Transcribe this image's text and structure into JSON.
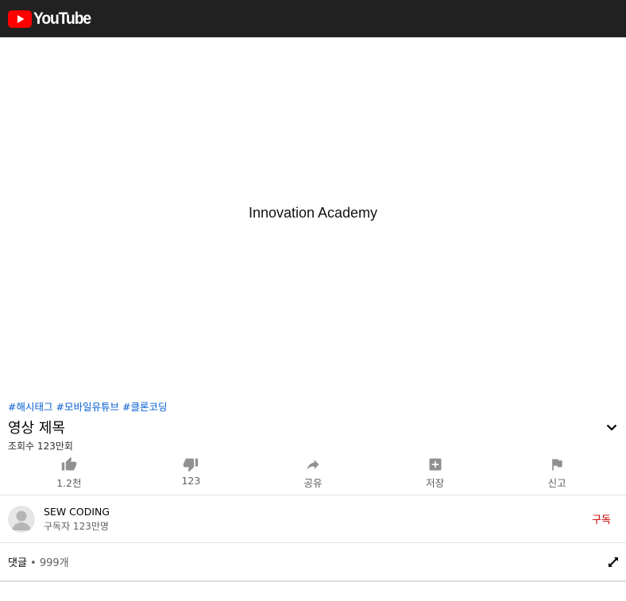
{
  "header": {
    "logo_text": "YouTube",
    "brand_color": "#ff0000",
    "bar_color": "#212121"
  },
  "player": {
    "title": "Innovation Academy"
  },
  "video": {
    "hashtags": [
      "#해시태그",
      "#모바일유튜브",
      "#클론코딩"
    ],
    "title": "영상 제목",
    "views": "조회수 123만회"
  },
  "actions": [
    {
      "icon": "thumbs-up-icon",
      "label": "1.2천"
    },
    {
      "icon": "thumbs-down-icon",
      "label": "123"
    },
    {
      "icon": "share-icon",
      "label": "공유"
    },
    {
      "icon": "add-to-playlist-icon",
      "label": "저장"
    },
    {
      "icon": "flag-icon",
      "label": "신고"
    }
  ],
  "channel": {
    "name": "SEW CODING",
    "subscribers": "구독자 123만명",
    "subscribe_label": "구독",
    "subscribe_color": "#cc0000"
  },
  "comments": {
    "label": "댓글",
    "separator": " • ",
    "count": "999개"
  }
}
